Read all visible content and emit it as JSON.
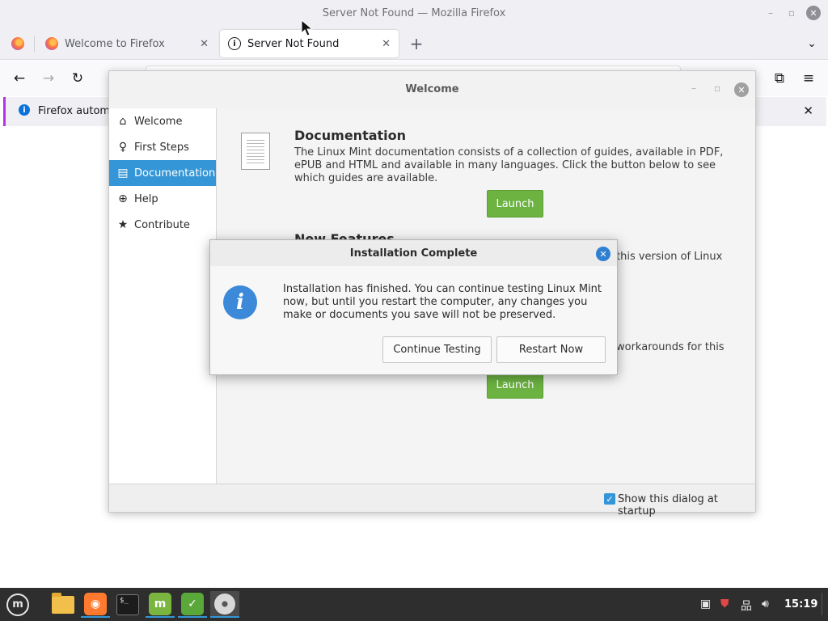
{
  "firefox": {
    "window_title": "Server Not Found — Mozilla Firefox",
    "tabs": [
      {
        "label": "Welcome to Firefox"
      },
      {
        "label": "Server Not Found"
      }
    ],
    "new_tab_glyph": "+",
    "notice_text": "Firefox automa",
    "colors": {
      "notice_accent": "#b832e6",
      "info_blue": "#0b72da"
    }
  },
  "welcome": {
    "title": "Welcome",
    "sidebar": {
      "items": [
        {
          "label": "Welcome",
          "icon": "home-icon"
        },
        {
          "label": "First Steps",
          "icon": "lightbulb-icon"
        },
        {
          "label": "Documentation",
          "icon": "book-icon"
        },
        {
          "label": "Help",
          "icon": "lifebuoy-icon"
        },
        {
          "label": "Contribute",
          "icon": "star-icon"
        }
      ],
      "active_index": 2
    },
    "sections": {
      "documentation": {
        "title": "Documentation",
        "text": "The Linux Mint documentation consists of a collection of guides, available in PDF, ePUB and HTML and available in many languages. Click the button below to see which guides are available.",
        "button": "Launch"
      },
      "new_features": {
        "title": "New Features",
        "text_fragment": "this version of Linux"
      },
      "release_notes": {
        "text_fragment": "workarounds for this",
        "button": "Launch"
      }
    },
    "footer": {
      "checkbox_label": "Show this dialog at startup",
      "checkbox_checked": true
    },
    "colors": {
      "accent": "#3496d6",
      "launch_green": "#6cb342"
    }
  },
  "dialog": {
    "title": "Installation Complete",
    "message": "Installation has finished.  You can continue testing Linux Mint now, but until you restart the computer, any changes you make or documents you save will not be preserved.",
    "buttons": {
      "continue": "Continue Testing",
      "restart": "Restart Now"
    },
    "icon": "info-icon"
  },
  "taskbar": {
    "clock": "15:19",
    "apps": [
      "mint-menu-icon",
      "files-icon",
      "firefox-icon",
      "terminal-icon",
      "mintinstall-icon",
      "mintupdate-icon",
      "disc-icon"
    ],
    "tray": [
      "clipboard-icon",
      "shield-icon",
      "network-icon",
      "volume-icon"
    ]
  }
}
